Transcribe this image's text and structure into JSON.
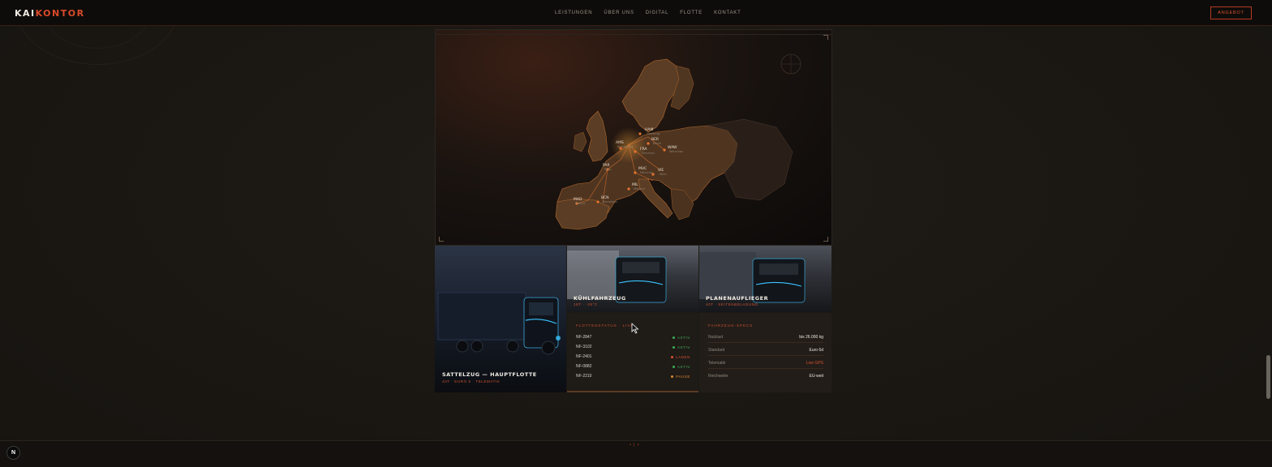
{
  "header": {
    "logo_part1": "KAI",
    "logo_part2": "KONTOR",
    "nav": [
      "LEISTUNGEN",
      "ÜBER UNS",
      "DIGITAL",
      "FLOTTE",
      "KONTAKT"
    ],
    "cta_label": "ANGEBOT"
  },
  "map": {
    "cities": [
      {
        "code": "HAM",
        "name": "Hamburg"
      },
      {
        "code": "BER",
        "name": "Berlin"
      },
      {
        "code": "WAW",
        "name": "Warschau"
      },
      {
        "code": "AMS",
        "name": "Amsterdam"
      },
      {
        "code": "FRA",
        "name": "Frankfurt"
      },
      {
        "code": "PAR",
        "name": "Paris"
      },
      {
        "code": "MUC",
        "name": "München"
      },
      {
        "code": "VIE",
        "name": "Wien"
      },
      {
        "code": "MIL",
        "name": "Mailand"
      },
      {
        "code": "MAD",
        "name": "Madrid"
      },
      {
        "code": "BCN",
        "name": "Barcelona"
      }
    ]
  },
  "tiles": {
    "main_title": "SATTELZUG — HAUPTFLOTTE",
    "main_sub": "40T · EURO 6 · TELEMATIK",
    "reefer_title": "KÜHLFAHRZEUG",
    "reefer_sub": "18T · -25°C",
    "curtain_title": "PLANENAUFLIEGER",
    "curtain_sub": "40T · SEITENBELADUNG"
  },
  "status": {
    "heading": "FLOTTENSTATUS · LIVE",
    "rows": [
      {
        "id": "NF-2847",
        "status": "AKTIV",
        "color": "#3fae5a"
      },
      {
        "id": "NF-3102",
        "status": "AKTIV",
        "color": "#3fae5a"
      },
      {
        "id": "NF-2401",
        "status": "LADEN",
        "color": "#d9532f"
      },
      {
        "id": "NF-0882",
        "status": "AKTIV",
        "color": "#3fae5a"
      },
      {
        "id": "NF-2210",
        "status": "PAUSE",
        "color": "#d98a2f"
      }
    ]
  },
  "specs": {
    "heading": "FAHRZEUG-SPECS",
    "rows": [
      {
        "key": "Nutzlast",
        "value": "bis 26.000 kg",
        "accent": false
      },
      {
        "key": "Standard",
        "value": "Euro 6d",
        "accent": false
      },
      {
        "key": "Telematik",
        "value": "Live GPS",
        "accent": true
      },
      {
        "key": "Reichweite",
        "value": "EU-weit",
        "accent": false
      }
    ]
  },
  "footer": {
    "pager": "• | •",
    "badge": "N"
  },
  "colors": {
    "accent": "#d9532f",
    "background": "#1a1713",
    "header": "#0e0c0a"
  }
}
